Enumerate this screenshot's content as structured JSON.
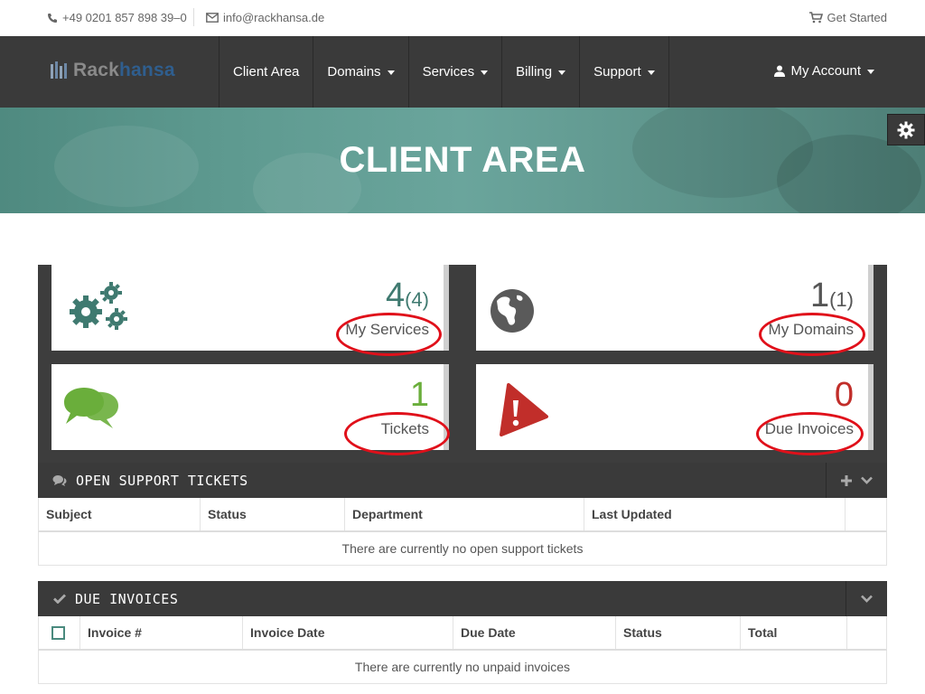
{
  "topbar": {
    "phone": "+49 0201 857 898 39–0",
    "email": "info@rackhansa.de",
    "get_started": "Get Started"
  },
  "brand": {
    "part1": "Rack",
    "part2": "hansa"
  },
  "nav": {
    "items": [
      {
        "label": "Client Area",
        "dropdown": false
      },
      {
        "label": "Domains",
        "dropdown": true
      },
      {
        "label": "Services",
        "dropdown": true
      },
      {
        "label": "Billing",
        "dropdown": true
      },
      {
        "label": "Support",
        "dropdown": true
      }
    ],
    "account": "My Account"
  },
  "banner": {
    "title": "CLIENT AREA"
  },
  "tiles": [
    {
      "count": "4",
      "sub": "(4)",
      "label": "My Services",
      "icon": "gears-icon",
      "color": "#3f7a70"
    },
    {
      "count": "1",
      "sub": "(1)",
      "label": "My Domains",
      "icon": "globe-icon",
      "color": "#555555"
    },
    {
      "count": "1",
      "sub": "",
      "label": "Tickets",
      "icon": "chat-bubbles-icon",
      "color": "#6aae3b"
    },
    {
      "count": "0",
      "sub": "",
      "label": "Due Invoices",
      "icon": "warning-icon",
      "color": "#c12e2a"
    }
  ],
  "tickets_panel": {
    "title": "OPEN SUPPORT TICKETS",
    "columns": [
      "Subject",
      "Status",
      "Department",
      "Last Updated"
    ],
    "empty_text": "There are currently no open support tickets"
  },
  "invoices_panel": {
    "title": "DUE INVOICES",
    "columns": [
      "Invoice #",
      "Invoice Date",
      "Due Date",
      "Status",
      "Total"
    ],
    "empty_text": "There are currently no unpaid invoices"
  },
  "colors": {
    "accent": "#4a8a7e",
    "dark": "#3a3a3a",
    "annotation": "#e0101a"
  }
}
